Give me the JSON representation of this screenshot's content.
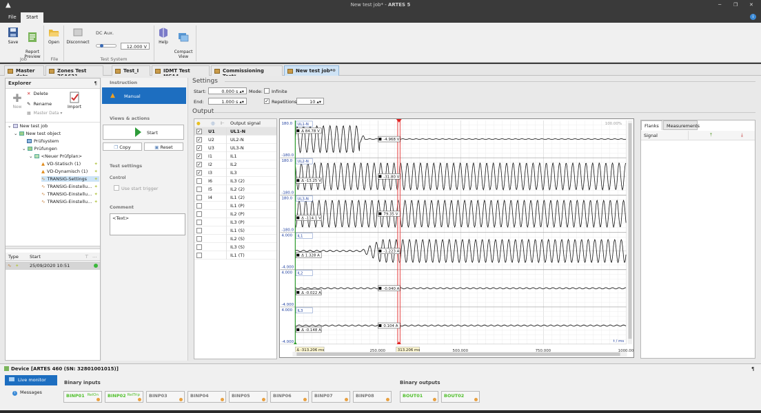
{
  "window": {
    "title_doc": "New test job*",
    "title_sep": " - ",
    "title_app": "ARTES 5"
  },
  "ribbon_tabs": [
    "File",
    "Start"
  ],
  "ribbon": {
    "save": "Save",
    "report_preview": "Report\nPreview",
    "open": "Open",
    "disconnect": "Disconnect",
    "dc_aux": "DC Aux.",
    "dc_aux_value": "12.000 V",
    "help": "Help",
    "compact_view": "Compact\nView",
    "groups": {
      "job": "Job",
      "file": "File",
      "test_system": "Test System"
    }
  },
  "doc_tabs": [
    "Master data",
    "Zones Test 7SA631",
    "Test_I",
    "IDMT Test MCA4",
    "Commissioning Test*",
    "New test job*"
  ],
  "explorer": {
    "title": "Explorer",
    "pin": "¶",
    "delete": "Delete",
    "rename": "Rename",
    "new": "New",
    "master_data": "Master Data",
    "import": "Import",
    "tree": [
      {
        "label": "New test job",
        "level": 0
      },
      {
        "label": "New test object",
        "level": 1
      },
      {
        "label": "Prüfsystem",
        "level": 2
      },
      {
        "label": "Prüfungen",
        "level": 2
      },
      {
        "label": "<Neuer Prüfplan>",
        "level": 3
      },
      {
        "label": "VD-Statisch (1)",
        "level": 4
      },
      {
        "label": "VD-Dynamisch (1)",
        "level": 4
      },
      {
        "label": "TRANSIG-Settings",
        "level": 4,
        "selected": true
      },
      {
        "label": "TRANSIG-Einstellu...",
        "level": 4
      },
      {
        "label": "TRANSIG-Einstellu...",
        "level": 4
      },
      {
        "label": "TRANSIG-Einstellu...",
        "level": 4
      }
    ],
    "grid_headers": {
      "type": "Type",
      "start": "Start"
    },
    "grid_row": {
      "start": "25/09/2020 10:51"
    }
  },
  "instruction": {
    "title": "Instruction",
    "manual": "Manual",
    "views_actions": "Views & actions",
    "start": "Start",
    "copy": "Copy",
    "reset": "Reset",
    "test_settings": "Test settings",
    "control": "Control",
    "use_start_trigger": "Use start trigger",
    "comment": "Comment",
    "comment_text": "<Text>"
  },
  "settings": {
    "title": "Settings",
    "start_label": "Start:",
    "start_value": "0.000 s",
    "mode_label": "Mode:",
    "infinite": "Infinite",
    "end_label": "End:",
    "end_value": "1.000 s",
    "repetitions_label": "Repetitions:",
    "repetitions_value": "10"
  },
  "output": {
    "title": "Output",
    "header": "Output signal",
    "rows": [
      {
        "ch": "U1",
        "sig": "UL1-N",
        "checked": true,
        "bold": true
      },
      {
        "ch": "U2",
        "sig": "UL2-N",
        "checked": true
      },
      {
        "ch": "U3",
        "sig": "UL3-N",
        "checked": true
      },
      {
        "ch": "I1",
        "sig": "IL1",
        "checked": true
      },
      {
        "ch": "I2",
        "sig": "IL2",
        "checked": true
      },
      {
        "ch": "I3",
        "sig": "IL3",
        "checked": true
      },
      {
        "ch": "I6",
        "sig": "IL3 (2)",
        "checked": false
      },
      {
        "ch": "I5",
        "sig": "IL2 (2)",
        "checked": false
      },
      {
        "ch": "I4",
        "sig": "IL1 (2)",
        "checked": false
      },
      {
        "ch": "",
        "sig": "IL1 (P)",
        "checked": false
      },
      {
        "ch": "",
        "sig": "IL2 (P)",
        "checked": false
      },
      {
        "ch": "",
        "sig": "IL3 (P)",
        "checked": false
      },
      {
        "ch": "",
        "sig": "IL1 (S)",
        "checked": false
      },
      {
        "ch": "",
        "sig": "IL2 (S)",
        "checked": false
      },
      {
        "ch": "",
        "sig": "IL3 (S)",
        "checked": false
      },
      {
        "ch": "",
        "sig": "IL1 (T)",
        "checked": false
      }
    ]
  },
  "chart_data": {
    "type": "line",
    "zoom": "100.00%",
    "x_unit": "t / ms",
    "x_ticks": [
      "250.000",
      "500.000",
      "750.000",
      "1000.000"
    ],
    "cursor_left": "Δ -313.206 ms",
    "cursor_right": "313.206 ms",
    "panels": [
      {
        "name": "UL1-N",
        "ymax": "180.0",
        "ymin": "-180.0",
        "delta": "Δ 84.78 V",
        "value": "-4.968 V",
        "pattern": "stop"
      },
      {
        "name": "UL2-N",
        "ymax": "180.0",
        "ymin": "-180.0",
        "delta": "Δ -13.25 V",
        "value": "-31.80 V",
        "pattern": "full"
      },
      {
        "name": "UL3-N",
        "ymax": "180.0",
        "ymin": "-180.0",
        "delta": "Δ -114.1 V",
        "value": "79.35 V",
        "pattern": "full"
      },
      {
        "name": "IL1",
        "ymax": "4.000",
        "ymin": "-4.000",
        "delta": "Δ 1.328 A",
        "value": "-1.223 A",
        "pattern": "late"
      },
      {
        "name": "IL2",
        "ymax": "4.000",
        "ymin": "-4.000",
        "delta": "Δ -0.022 A",
        "value": "-0.040 A",
        "pattern": "flat"
      },
      {
        "name": "IL3",
        "ymax": "4.000",
        "ymin": "-4.000",
        "delta": "Δ -0.148 A",
        "value": "0.104 A",
        "pattern": "flat"
      }
    ]
  },
  "right_panel": {
    "tabs": [
      "Flanks",
      "Measurements"
    ],
    "col": "Signal"
  },
  "device": {
    "title": "Device [ARTES 460 (SN: 32801001015)]",
    "live_monitor": "Live monitor",
    "messages": "Messages",
    "binary_inputs": "Binary inputs",
    "binary_outputs": "Binary outputs",
    "inputs": [
      {
        "name": "BINP01",
        "sub": "RelOn",
        "on": true
      },
      {
        "name": "BINP02",
        "sub": "RelTrip",
        "on": true
      },
      {
        "name": "BINP03",
        "sub": "",
        "on": false
      },
      {
        "name": "BINP04",
        "sub": "",
        "on": false
      },
      {
        "name": "BINP05",
        "sub": "",
        "on": false
      },
      {
        "name": "BINP06",
        "sub": "",
        "on": false
      },
      {
        "name": "BINP07",
        "sub": "",
        "on": false
      },
      {
        "name": "BINP08",
        "sub": "",
        "on": false
      }
    ],
    "outputs": [
      {
        "name": "BOUT01",
        "on": true
      },
      {
        "name": "BOUT02",
        "on": true
      }
    ]
  }
}
